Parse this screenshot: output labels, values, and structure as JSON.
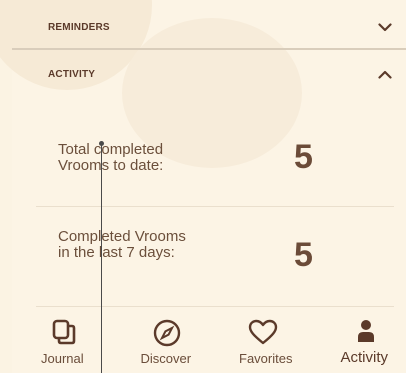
{
  "sections": {
    "reminders": {
      "label": "REMINDERS",
      "icon": "chevron-down-icon"
    },
    "activity": {
      "label": "ACTIVITY",
      "icon": "chevron-up-icon"
    }
  },
  "stats": [
    {
      "label": "Total completed Vrooms to date:",
      "value": "5"
    },
    {
      "label": "Completed Vrooms in the last 7 days:",
      "value": "5"
    }
  ],
  "tabs": [
    {
      "label": "Journal",
      "icon": "journal-icon"
    },
    {
      "label": "Discover",
      "icon": "compass-icon"
    },
    {
      "label": "Favorites",
      "icon": "heart-icon"
    },
    {
      "label": "Activity",
      "icon": "person-icon",
      "active": true
    }
  ],
  "colors": {
    "background": "#fcf4e5",
    "text": "#6a4d3a",
    "divider": "#d9cdbb"
  }
}
